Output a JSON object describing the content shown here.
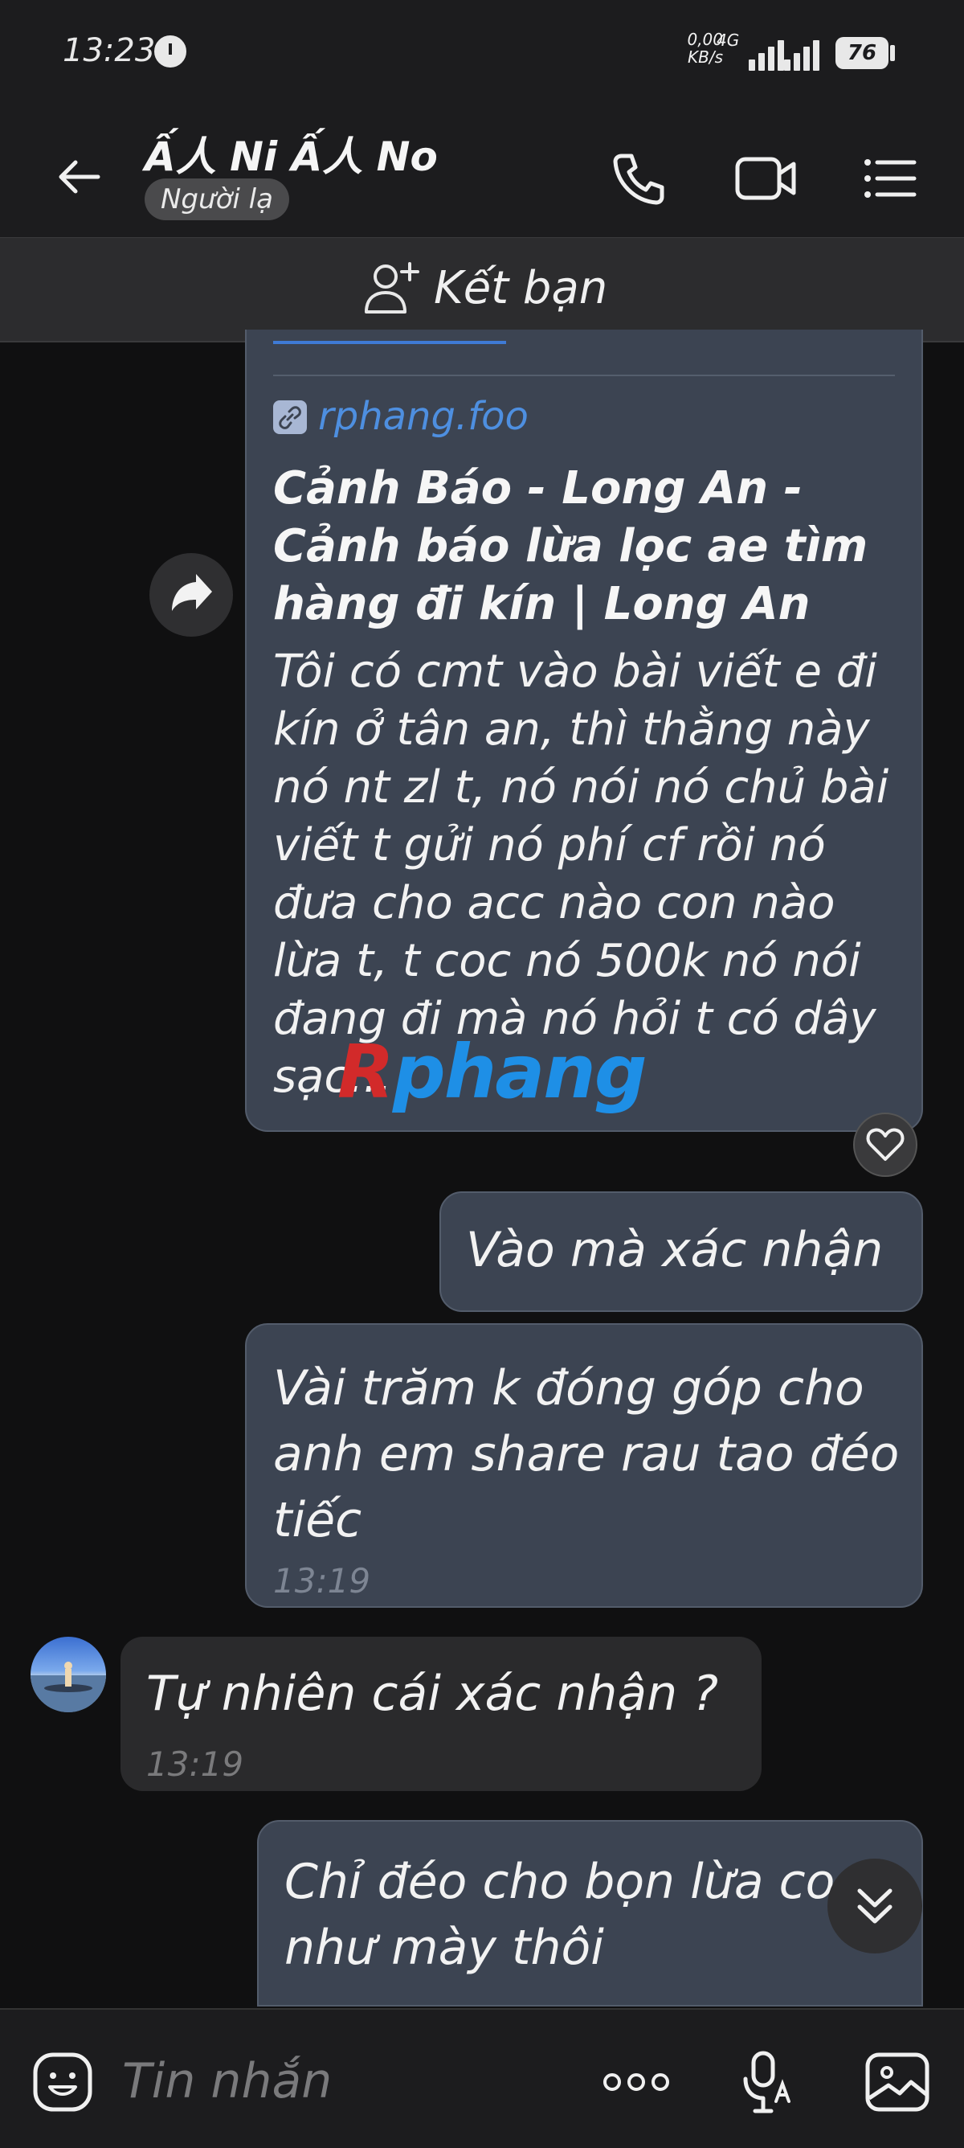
{
  "status_bar": {
    "time": "13:23",
    "net_speed_value": "0,00",
    "net_speed_unit": "KB/s",
    "network_type": "4G",
    "battery": "76"
  },
  "header": {
    "contact_name": "Ấ人 Ni Ấ人 No",
    "stranger_badge": "Người lạ"
  },
  "add_friend": {
    "label": "Kết bạn"
  },
  "link_card": {
    "domain": "rphang.foo",
    "title": "Cảnh Báo - Long An - Cảnh báo lừa lọc ae tìm hàng đi kín | Long An",
    "description": "Tôi có cmt vào bài viết e đi kín ở tân an, thì thằng này nó nt zl t, nó nói nó chủ bài viết t gửi nó phí cf rồi nó đưa cho acc nào con nào lừa t, t coc nó 500k nó nói đang đi mà nó hỏi t có dây sạc..."
  },
  "watermark": {
    "prefix": "R",
    "text": "phang"
  },
  "messages": [
    {
      "direction": "out",
      "text": "Vào mà xác nhận"
    },
    {
      "direction": "out",
      "text": "Vài trăm k đóng góp cho anh em share rau tao đéo tiếc",
      "time": "13:19"
    },
    {
      "direction": "in",
      "text": "Tự nhiên cái xác nhận ?",
      "time": "13:19"
    },
    {
      "direction": "out",
      "text": "Chỉ đéo cho bọn lừa co như mày thôi"
    }
  ],
  "composer": {
    "placeholder": "Tin nhắn"
  },
  "icons": {
    "back": "back-arrow-icon",
    "call": "phone-icon",
    "video": "video-camera-icon",
    "menu": "list-menu-icon",
    "add_friend": "add-user-icon",
    "forward": "forward-icon",
    "heart": "heart-icon",
    "scroll_down": "chevron-double-down-icon",
    "sticker": "sticker-icon",
    "more": "more-dots-icon",
    "voice": "voice-to-text-icon",
    "image": "image-icon"
  },
  "colors": {
    "background": "#101011",
    "outgoing_bubble": "#3c4452",
    "incoming_bubble": "#2a2a2c",
    "link": "#4e8fe0"
  }
}
